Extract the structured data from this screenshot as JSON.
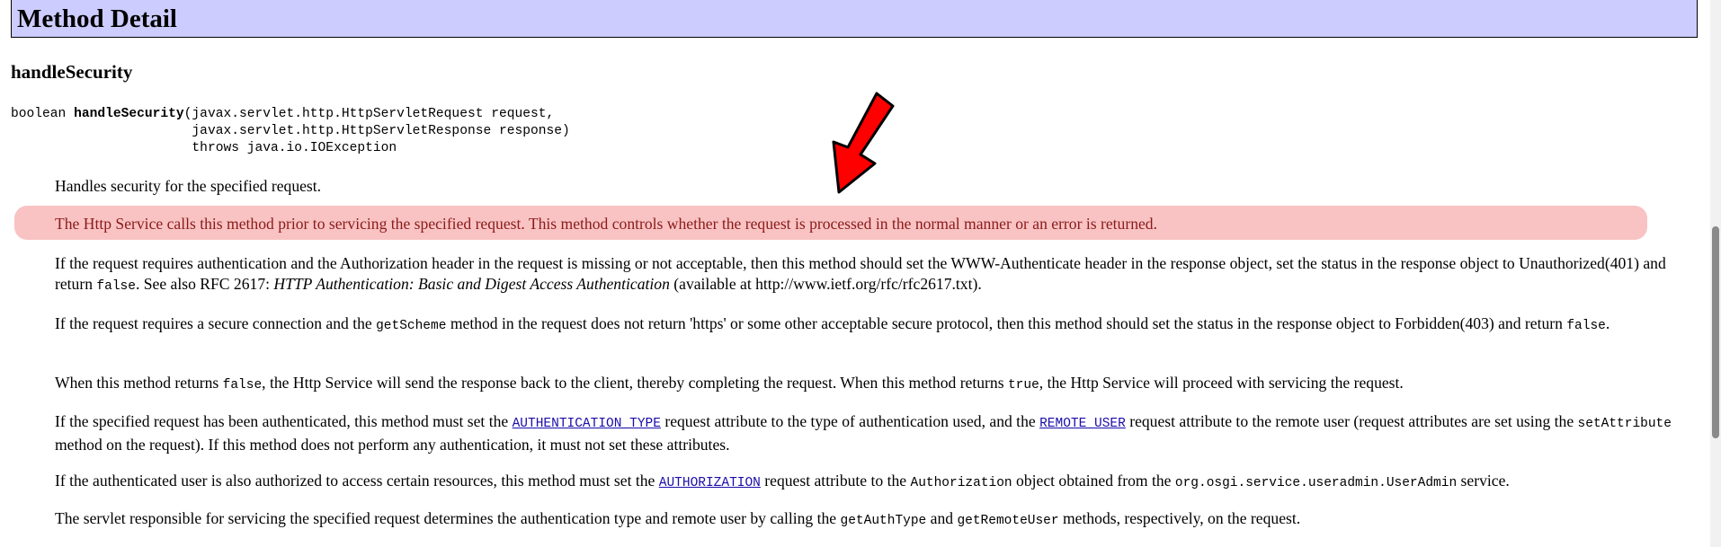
{
  "header": {
    "title": "Method Detail"
  },
  "method": {
    "name": "handleSecurity",
    "signature": {
      "line1_type": "boolean ",
      "line1_name": "handleSecurity",
      "line1_rest": "(javax.servlet.http.HttpServletRequest request,",
      "line2": "                       javax.servlet.http.HttpServletResponse response)",
      "line3": "                       throws java.io.IOException"
    }
  },
  "desc": {
    "p1": "Handles security for the specified request.",
    "p2": "The Http Service calls this method prior to servicing the specified request. This method controls whether the request is processed in the normal manner or an error is returned.",
    "p3_a": "If the request requires authentication and the Authorization header in the request is missing or not acceptable, then this method should set the WWW-Authenticate header in the response object, set the status in the response object to Unauthorized(401) and return ",
    "p3_code": "false",
    "p3_b": ". See also RFC 2617: ",
    "p3_em": "HTTP Authentication: Basic and Digest Access Authentication",
    "p3_c": " (available at http://www.ietf.org/rfc/rfc2617.txt).",
    "p4_a": "If the request requires a secure connection and the ",
    "p4_code1": "getScheme",
    "p4_b": " method in the request does not return 'https' or some other acceptable secure protocol, then this method should set the status in the response object to Forbidden(403) and return ",
    "p4_code2": "false",
    "p4_c": ".",
    "p5_a": "When this method returns ",
    "p5_code1": "false",
    "p5_b": ", the Http Service will send the response back to the client, thereby completing the request. When this method returns ",
    "p5_code2": "true",
    "p5_c": ", the Http Service will proceed with servicing the request.",
    "p6_a": "If the specified request has been authenticated, this method must set the ",
    "p6_link1": "AUTHENTICATION_TYPE",
    "p6_b": " request attribute to the type of authentication used, and the ",
    "p6_link2": "REMOTE_USER",
    "p6_c": " request attribute to the remote user (request attributes are set using the ",
    "p6_code": "setAttribute",
    "p6_d": " method on the request). If this method does not perform any authentication, it must not set these attributes.",
    "p7_a": "If the authenticated user is also authorized to access certain resources, this method must set the ",
    "p7_link": "AUTHORIZATION",
    "p7_b": " request attribute to the ",
    "p7_code1": "Authorization",
    "p7_c": " object obtained from the ",
    "p7_code2": "org.osgi.service.useradmin.UserAdmin",
    "p7_d": " service.",
    "p8_a": "The servlet responsible for servicing the specified request determines the authentication type and remote user by calling the ",
    "p8_code1": "getAuthType",
    "p8_b": " and ",
    "p8_code2": "getRemoteUser",
    "p8_c": " methods, respectively, on the request."
  },
  "colors": {
    "header_bg": "#ccccff",
    "highlight_bg": "#f9c3c3",
    "arrow": "#ff0000",
    "link": "#1a0dab"
  },
  "icons": {
    "annotation": "red-arrow-icon"
  }
}
